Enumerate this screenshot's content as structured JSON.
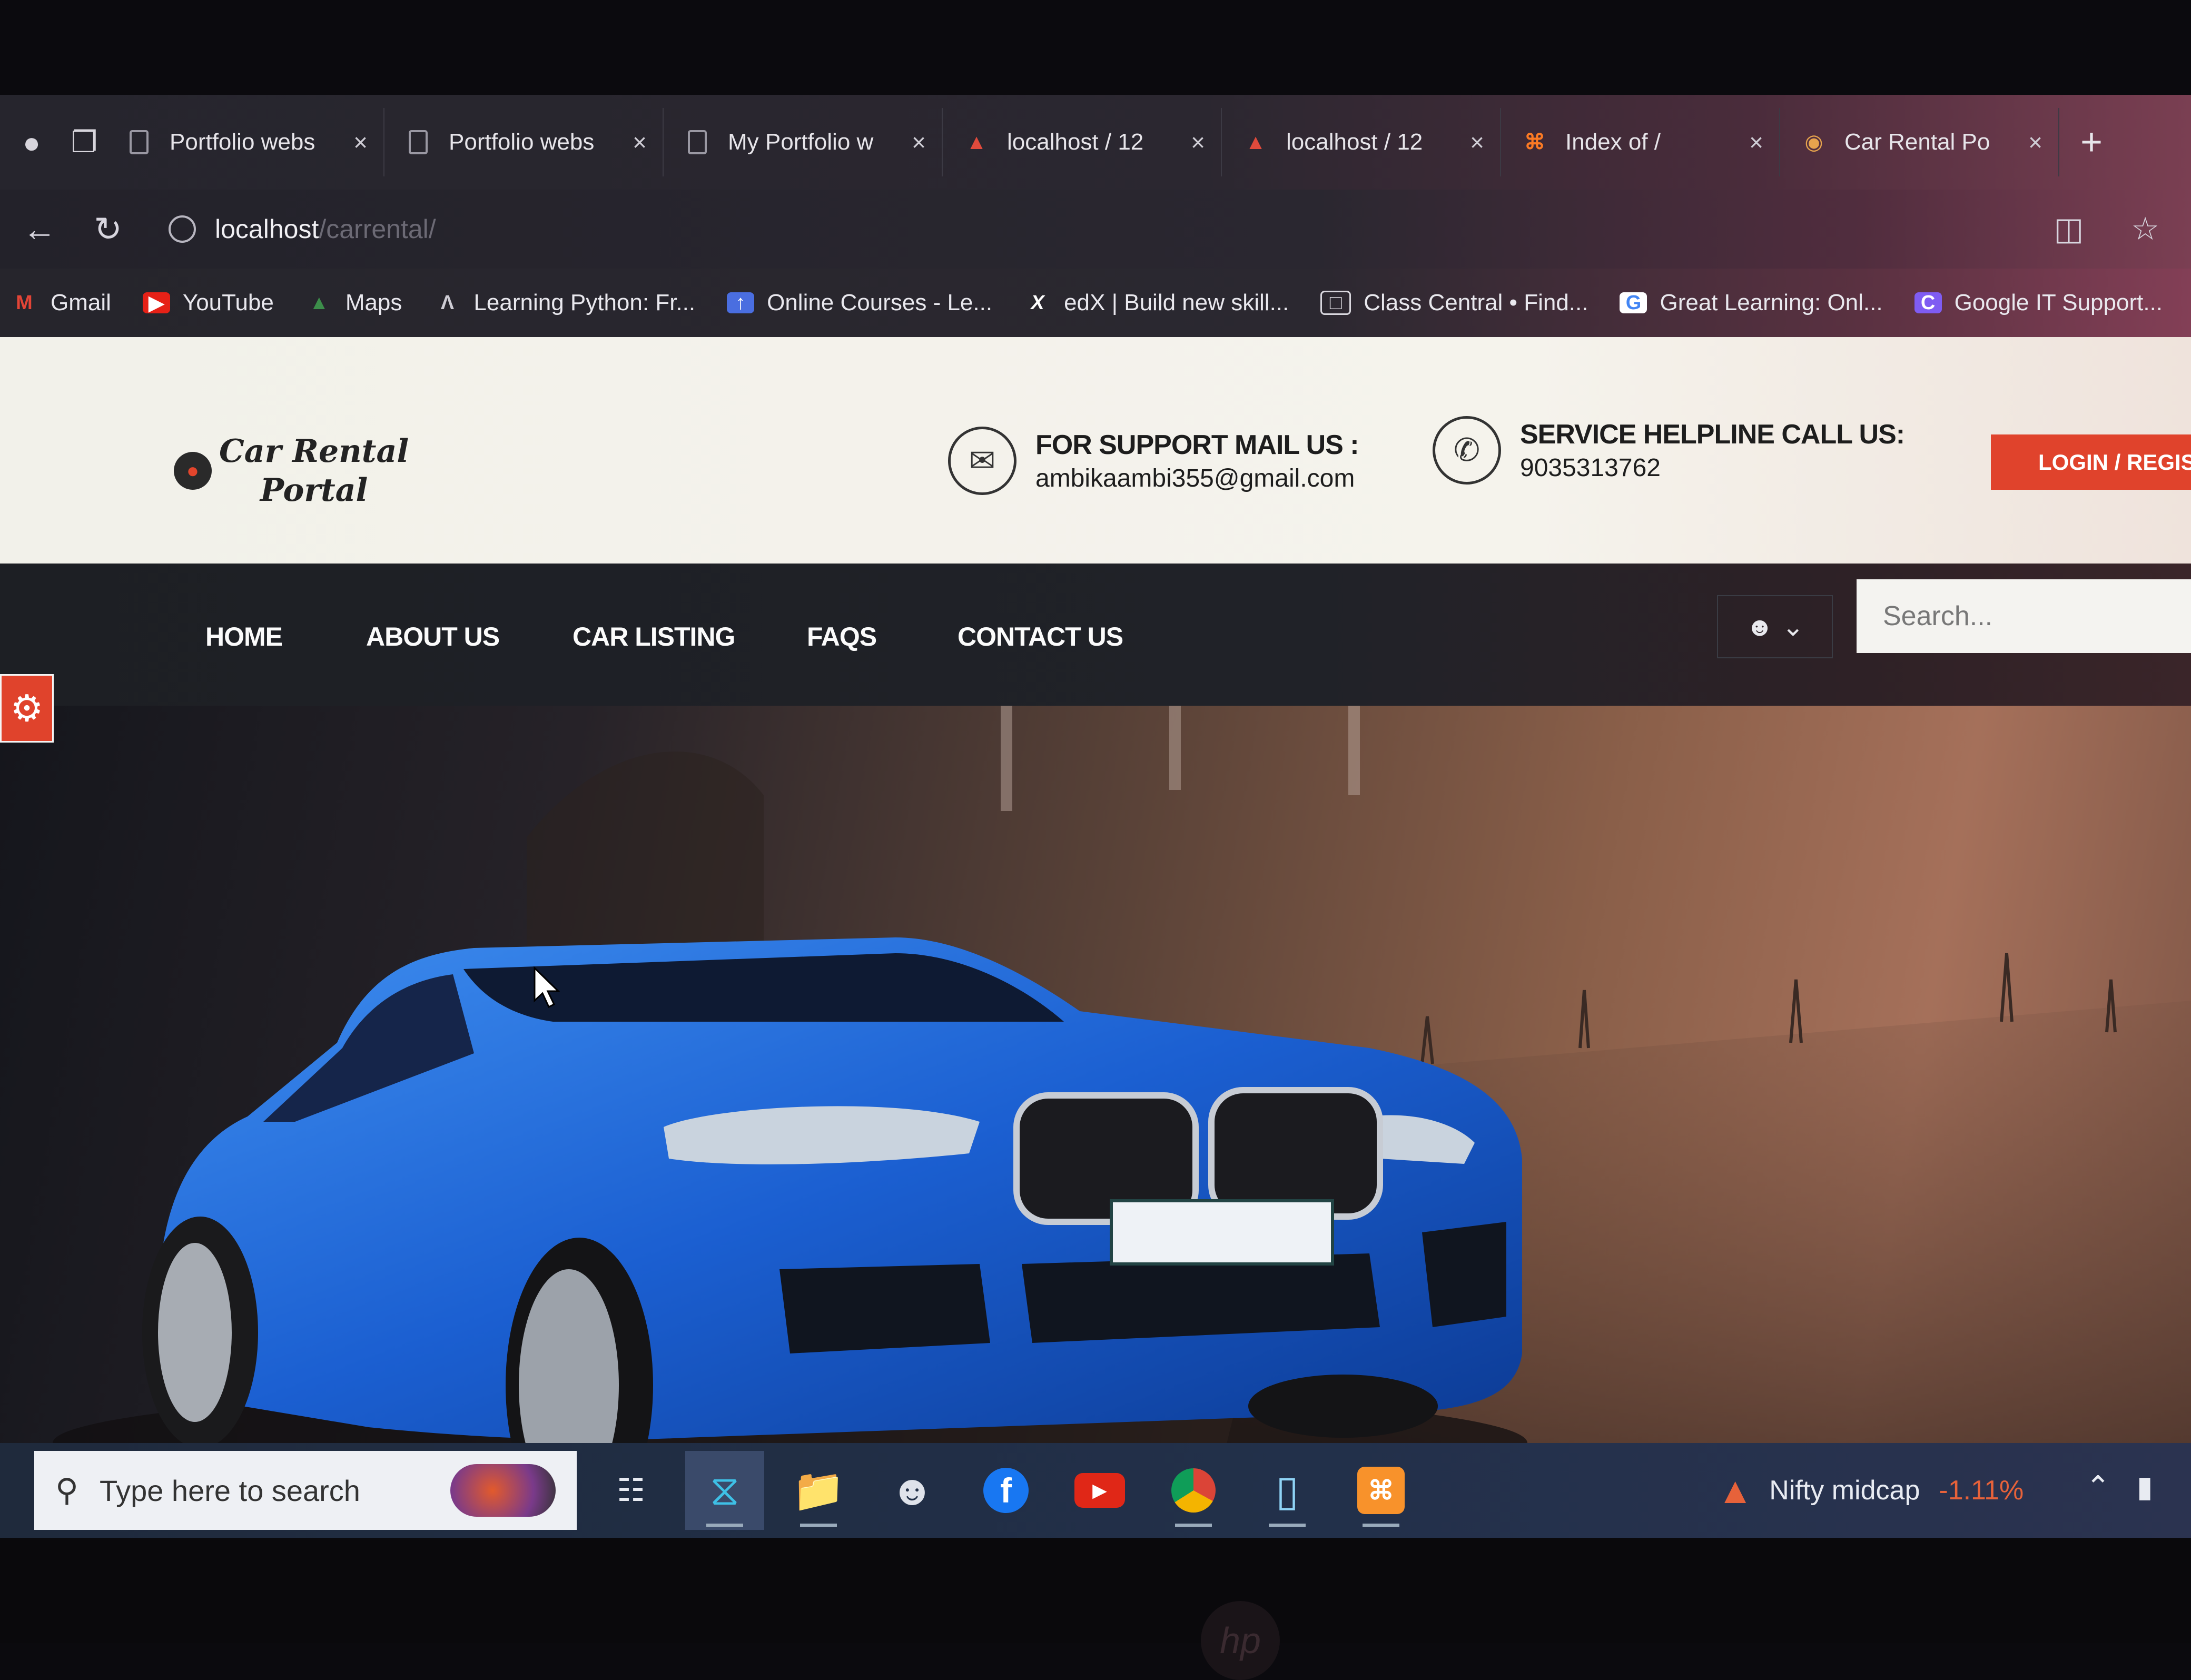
{
  "browser": {
    "tabs": [
      {
        "label": "Portfolio webs",
        "icon": "document-icon"
      },
      {
        "label": "Portfolio webs",
        "icon": "document-icon"
      },
      {
        "label": "My Portfolio w",
        "icon": "document-icon"
      },
      {
        "label": "localhost / 12",
        "icon": "phpmyadmin-icon"
      },
      {
        "label": "localhost / 12",
        "icon": "phpmyadmin-icon"
      },
      {
        "label": "Index of /",
        "icon": "xampp-icon"
      },
      {
        "label": "Car Rental Po",
        "icon": "car-icon"
      }
    ],
    "tab_close": "×",
    "new_tab": "+",
    "url_host": "localhost",
    "url_path": "/carrental/",
    "bookmarks": [
      {
        "label": "Gmail",
        "icon": "gmail-icon"
      },
      {
        "label": "YouTube",
        "icon": "youtube-icon"
      },
      {
        "label": "Maps",
        "icon": "maps-icon"
      },
      {
        "label": "Learning Python: Fr...",
        "icon": "learning-icon"
      },
      {
        "label": "Online Courses - Le...",
        "icon": "online-courses-icon"
      },
      {
        "label": "edX | Build new skill...",
        "icon": "edx-icon"
      },
      {
        "label": "Class Central • Find...",
        "icon": "class-central-icon"
      },
      {
        "label": "Great Learning: Onl...",
        "icon": "great-learning-icon"
      },
      {
        "label": "Google IT Support...",
        "icon": "coursera-icon"
      }
    ]
  },
  "site": {
    "logo_line1": "Car Rental",
    "logo_line2": "Portal",
    "mail_title": "FOR SUPPORT MAIL US :",
    "mail_value": "ambikaambi355@gmail.com",
    "phone_title": "SERVICE HELPLINE CALL US:",
    "phone_value": "9035313762",
    "login_label": "LOGIN / REGIS",
    "nav": [
      "HOME",
      "ABOUT US",
      "CAR LISTING",
      "FAQS",
      "CONTACT US"
    ],
    "search_placeholder": "Search...",
    "accent_color": "#e0432c"
  },
  "taskbar": {
    "search_placeholder": "Type here to search",
    "apps": [
      "task-view-icon",
      "edge-icon",
      "file-explorer-icon",
      "avatar-app-icon",
      "facebook-icon",
      "youtube-icon",
      "chrome-icon",
      "notes-icon",
      "xampp-icon"
    ],
    "stock_name": "Nifty midcap",
    "stock_change": "-1.11%"
  }
}
